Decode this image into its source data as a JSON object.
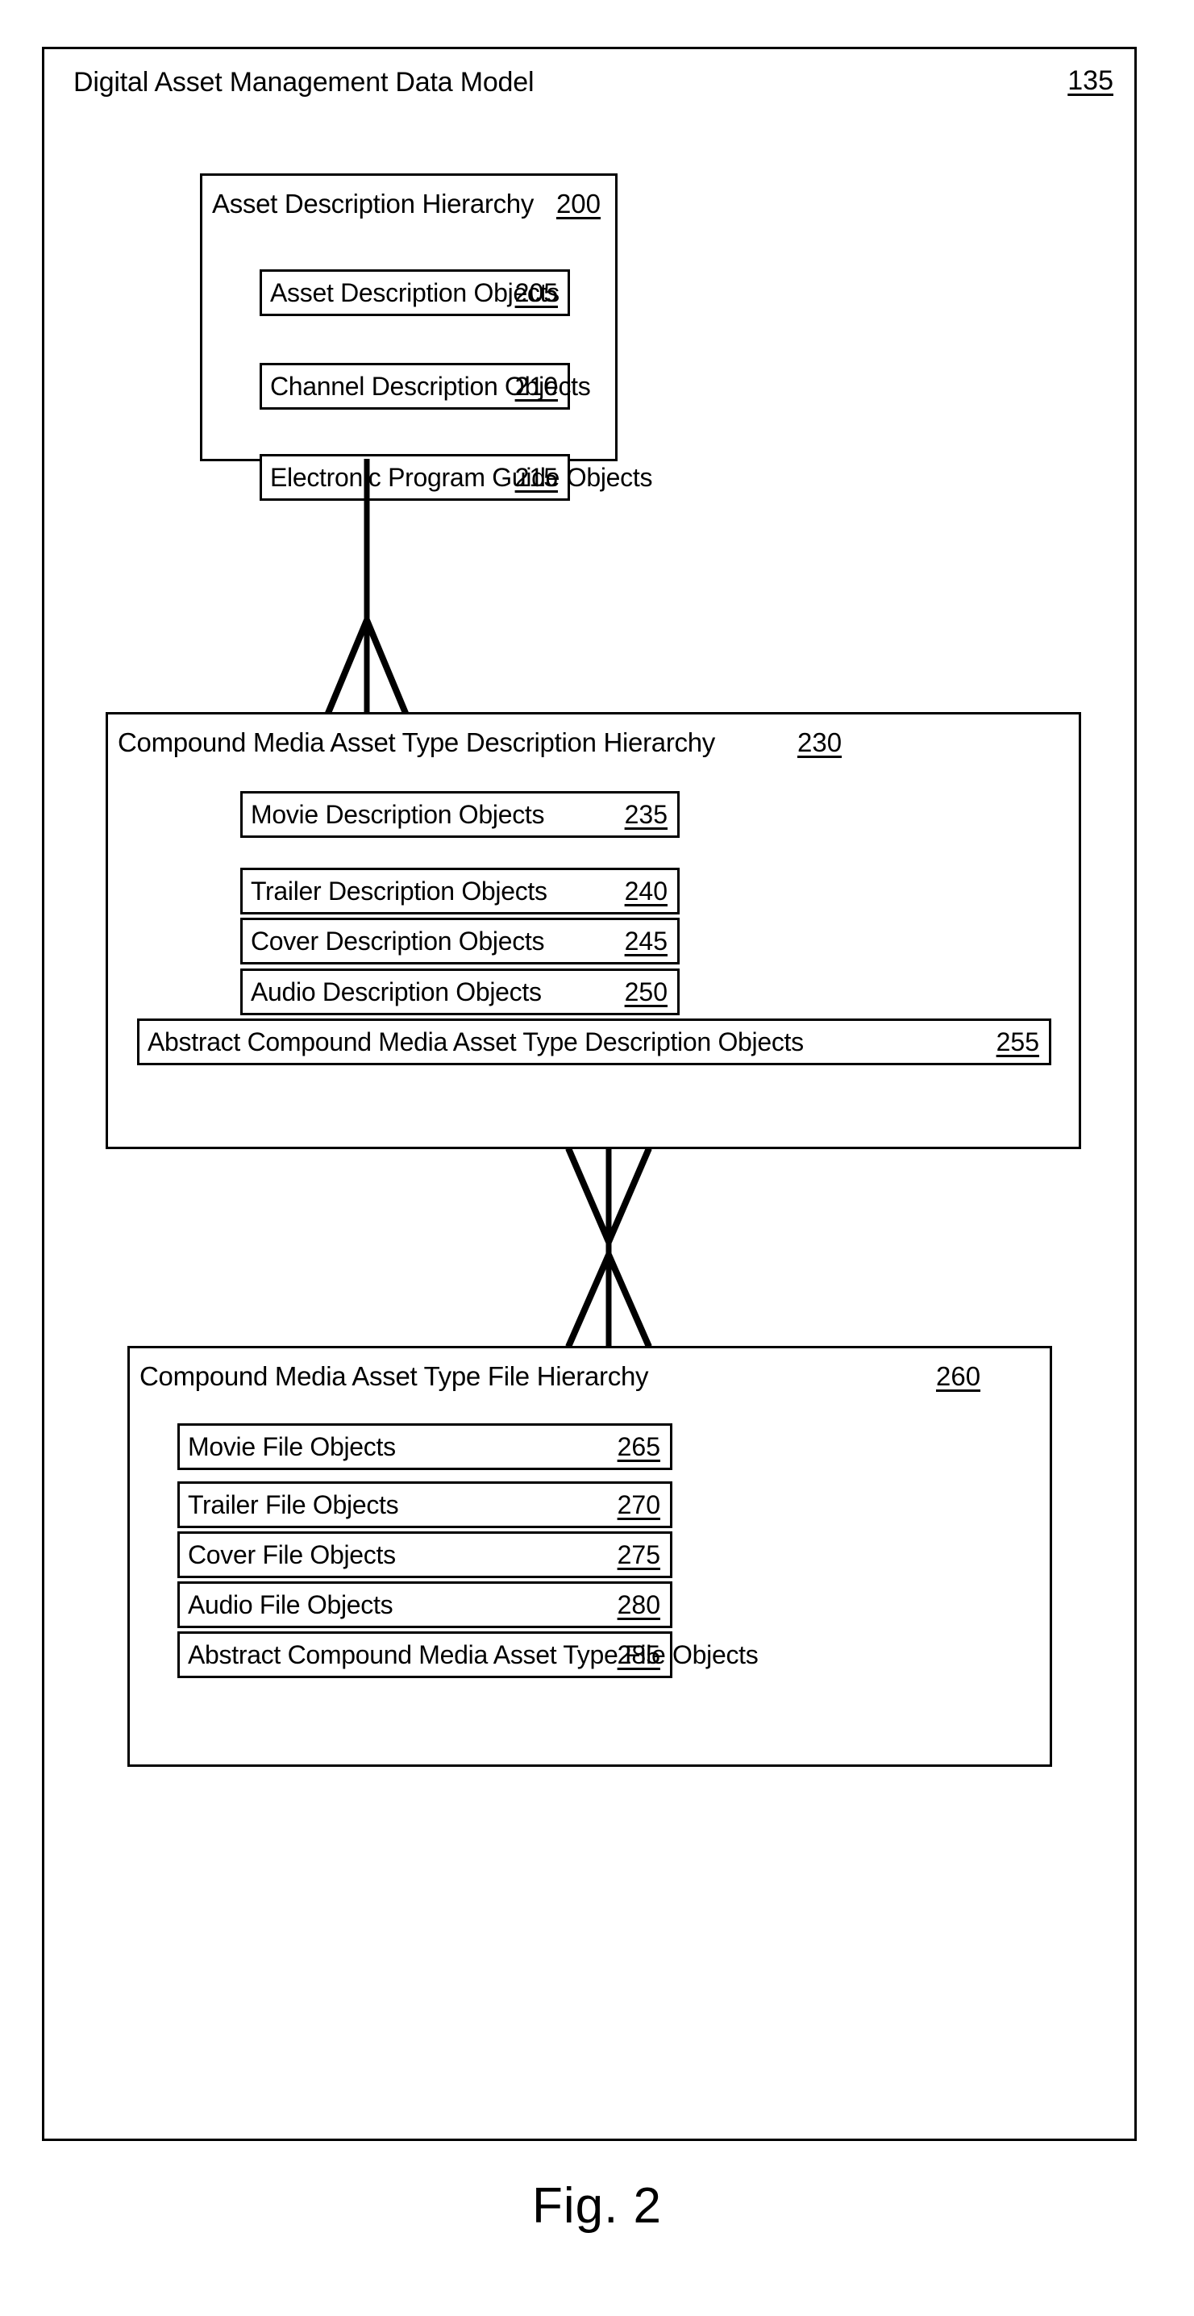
{
  "figure": {
    "caption": "Fig. 2",
    "model_title": "Digital Asset Management Data Model",
    "model_ref": "135"
  },
  "groups": [
    {
      "name": "asset-description-hierarchy",
      "title": "Asset Description Hierarchy",
      "ref": "200",
      "items": [
        {
          "label": "Asset Description Objects",
          "ref": "205"
        },
        {
          "label": "Channel Description Objects",
          "ref": "210"
        },
        {
          "label": "Electronic Program Guide Objects",
          "ref": "215"
        }
      ]
    },
    {
      "name": "compound-media-asset-type-description-hierarchy",
      "title": "Compound Media Asset Type Description Hierarchy",
      "ref": "230",
      "items": [
        {
          "label": "Movie Description Objects",
          "ref": "235"
        },
        {
          "label": "Trailer Description Objects",
          "ref": "240"
        },
        {
          "label": "Cover Description Objects",
          "ref": "245"
        },
        {
          "label": "Audio Description Objects",
          "ref": "250"
        },
        {
          "label": "Abstract Compound Media Asset Type Description Objects",
          "ref": "255"
        }
      ]
    },
    {
      "name": "compound-media-asset-type-file-hierarchy",
      "title": "Compound Media Asset Type File Hierarchy",
      "ref": "260",
      "items": [
        {
          "label": "Movie File Objects",
          "ref": "265"
        },
        {
          "label": "Trailer File Objects",
          "ref": "270"
        },
        {
          "label": "Cover File Objects",
          "ref": "275"
        },
        {
          "label": "Audio File Objects",
          "ref": "280"
        },
        {
          "label": "Abstract Compound Media Asset Type File Objects",
          "ref": "285"
        }
      ]
    }
  ],
  "connectors": [
    {
      "name": "connector-asset-to-compound-description",
      "notation": "crows-foot"
    },
    {
      "name": "connector-compound-description-to-file",
      "notation": "double-crows-foot"
    }
  ],
  "colors": {
    "line": "#000000",
    "background": "#ffffff"
  }
}
